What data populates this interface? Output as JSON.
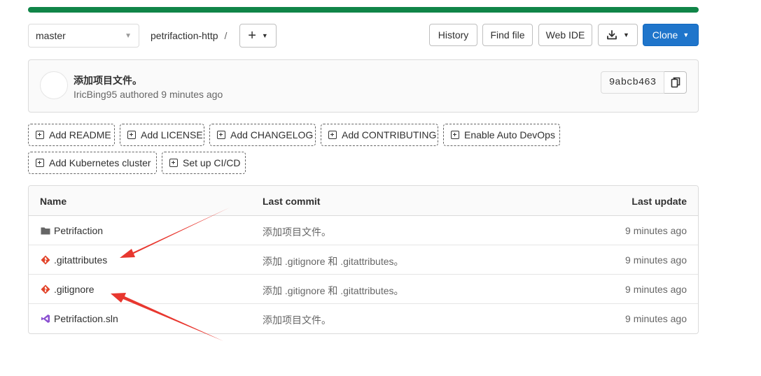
{
  "progress": {
    "value": 1.0,
    "color": "#108548"
  },
  "nav": {
    "branch": "master",
    "project": "petrifaction-http",
    "separator": "/",
    "add_icon": "plus-icon"
  },
  "actions": {
    "history": "History",
    "find_file": "Find file",
    "web_ide": "Web IDE",
    "download_icon": "download-icon",
    "clone": "Clone"
  },
  "commit": {
    "title": "添加项目文件。",
    "meta": "IricBing95 authored 9 minutes ago",
    "sha": "9abcb463",
    "copy_icon": "copy-icon"
  },
  "quick_actions": [
    "Add README",
    "Add LICENSE",
    "Add CHANGELOG",
    "Add CONTRIBUTING",
    "Enable Auto DevOps",
    "Add Kubernetes cluster",
    "Set up CI/CD"
  ],
  "tree": {
    "headers": {
      "name": "Name",
      "last_commit": "Last commit",
      "last_update": "Last update"
    },
    "rows": [
      {
        "name": "Petrifaction",
        "icon": "folder-icon",
        "commit": "添加项目文件。",
        "updated": "9 minutes ago"
      },
      {
        "name": ".gitattributes",
        "icon": "git-file-icon",
        "commit": "添加 .gitignore 和 .gitattributes。",
        "updated": "9 minutes ago"
      },
      {
        "name": ".gitignore",
        "icon": "git-file-icon",
        "commit": "添加 .gitignore 和 .gitattributes。",
        "updated": "9 minutes ago"
      },
      {
        "name": "Petrifaction.sln",
        "icon": "visual-studio-icon",
        "commit": "添加项目文件。",
        "updated": "9 minutes ago"
      }
    ]
  },
  "colors": {
    "accent_blue": "#1f75cb",
    "progress_green": "#108548",
    "annotation_red": "#e8372f",
    "git_orange": "#e24329",
    "vs_purple": "#8a4fd1"
  }
}
